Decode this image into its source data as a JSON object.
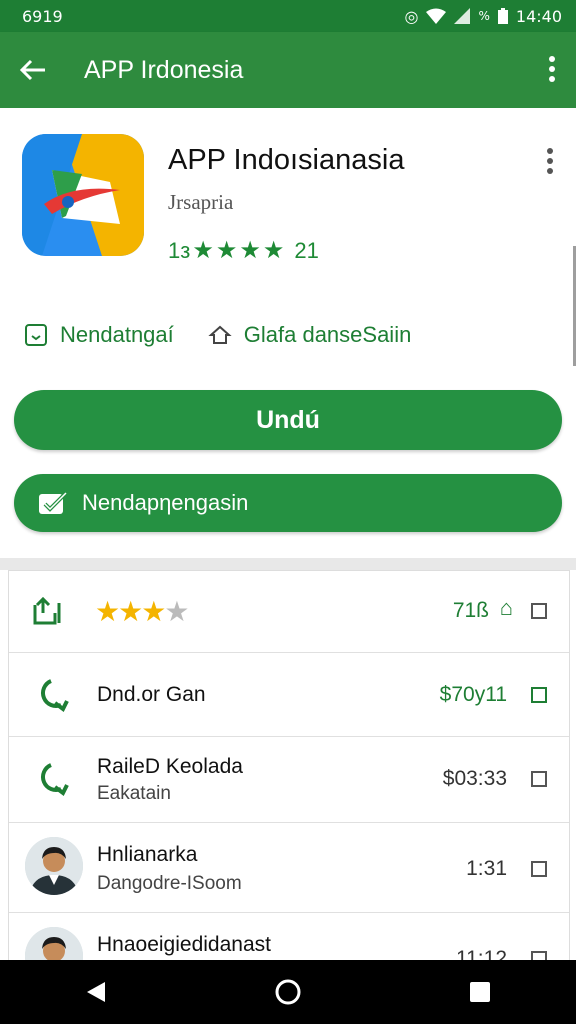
{
  "status_bar": {
    "time_left": "6919",
    "time_right": "14:40"
  },
  "app_bar": {
    "title": "APP Irdonesia"
  },
  "app": {
    "name": "APP Indoısianasia",
    "developer": "Jrsapria",
    "rating_prefix": "1з",
    "rating_count": "21"
  },
  "info": {
    "item1": "Nendatngaí",
    "item2": "Glafa danseSaiin"
  },
  "buttons": {
    "install": "Undú",
    "secondary": "Nendapηengasin"
  },
  "list": [
    {
      "value": "71ß"
    },
    {
      "title": "Dnd.or Gan",
      "value": "$70y11"
    },
    {
      "title": "RaileD Keolada",
      "subtitle": "Eakatain",
      "value": "$03:33"
    },
    {
      "title": "Hnlianarka",
      "subtitle": "Dangodre-ISoom",
      "value": "1:31"
    },
    {
      "title": "Hnaoeigiedidanast",
      "value": "11:12"
    }
  ],
  "colors": {
    "primary": "#2e8b3e",
    "status": "#1e7e34",
    "button": "#259142",
    "star_gold": "#f4b400"
  }
}
